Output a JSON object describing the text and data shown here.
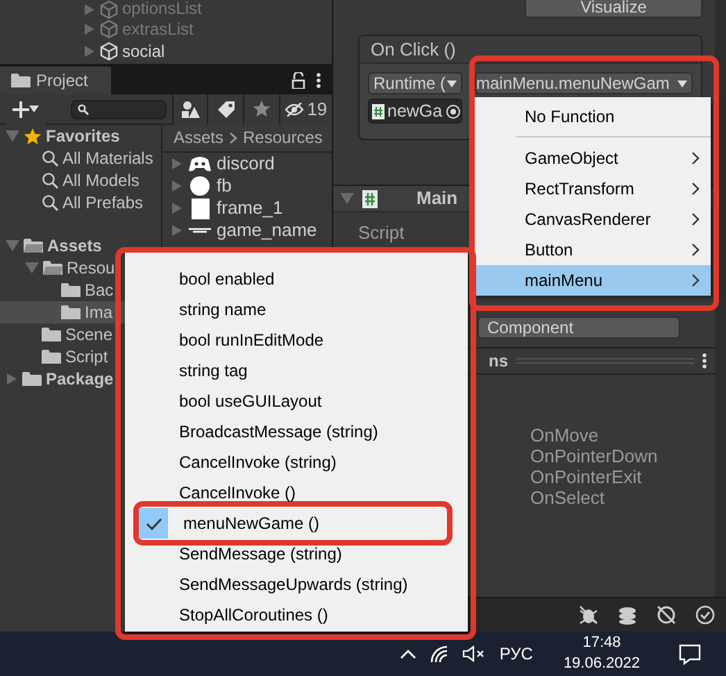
{
  "hierarchy": [
    {
      "label": "optionsList",
      "active": false
    },
    {
      "label": "extrasList",
      "active": false
    },
    {
      "label": "social",
      "active": true
    }
  ],
  "project": {
    "tab": "Project",
    "hidden_count": "19",
    "tree": [
      {
        "label": "Favorites",
        "kind": "favorites",
        "expanded": true,
        "selected": false,
        "children": [
          {
            "label": "All Materials",
            "kind": "search",
            "selected": false
          },
          {
            "label": "All Models",
            "kind": "search",
            "selected": false
          },
          {
            "label": "All Prefabs",
            "kind": "search",
            "selected": false
          }
        ]
      },
      {
        "label": "Assets",
        "kind": "folder",
        "expanded": true,
        "selected": false,
        "children": [
          {
            "label": "Resou",
            "kind": "folder",
            "expanded": true,
            "selected": false,
            "children": [
              {
                "label": "Bac",
                "kind": "folder",
                "selected": false
              },
              {
                "label": "Ima",
                "kind": "folder",
                "selected": true
              }
            ]
          },
          {
            "label": "Scene",
            "kind": "folder",
            "selected": false
          },
          {
            "label": "Script",
            "kind": "folder",
            "selected": false
          }
        ]
      },
      {
        "label": "Package",
        "kind": "folder",
        "expanded": false,
        "selected": false
      }
    ],
    "breadcrumb": [
      "Assets",
      "Resources"
    ],
    "assets": [
      {
        "label": "discord",
        "kind": "gamepad"
      },
      {
        "label": "fb",
        "kind": "round"
      },
      {
        "label": "frame_1",
        "kind": "sprite"
      },
      {
        "label": "game_name",
        "kind": "banner"
      }
    ]
  },
  "inspector": {
    "visualize": "Visualize",
    "on_click": {
      "title": "On Click ()",
      "runtime": "Runtime (",
      "function": "mainMenu.menuNewGam",
      "object": "newGa"
    },
    "component": {
      "title": "Main",
      "fields": [
        "Script"
      ],
      "add_button": "Component"
    },
    "events": {
      "title": "ns",
      "rows": [
        {
          "name": "OnMove"
        },
        {
          "name": "OnPointerDown"
        },
        {
          "name": "OnPointerExit"
        },
        {
          "name": "OnSelect"
        }
      ]
    }
  },
  "function_menu": [
    {
      "kind": "plain",
      "label": "No Function",
      "selected": false
    },
    {
      "kind": "separator"
    },
    {
      "kind": "submenu",
      "label": "GameObject",
      "selected": false
    },
    {
      "kind": "submenu",
      "label": "RectTransform",
      "selected": false
    },
    {
      "kind": "submenu",
      "label": "CanvasRenderer",
      "selected": false
    },
    {
      "kind": "submenu",
      "label": "Button",
      "selected": false
    },
    {
      "kind": "submenu",
      "label": "mainMenu",
      "selected": true
    }
  ],
  "method_menu": [
    {
      "label": "bool enabled",
      "checked": false
    },
    {
      "label": "string name",
      "checked": false
    },
    {
      "label": "bool runInEditMode",
      "checked": false
    },
    {
      "label": "string tag",
      "checked": false
    },
    {
      "label": "bool useGUILayout",
      "checked": false
    },
    {
      "label": "BroadcastMessage (string)",
      "checked": false
    },
    {
      "label": "CancelInvoke (string)",
      "checked": false
    },
    {
      "label": "CancelInvoke ()",
      "checked": false
    },
    {
      "label": "menuNewGame ()",
      "checked": true
    },
    {
      "label": "SendMessage (string)",
      "checked": false
    },
    {
      "label": "SendMessageUpwards (string)",
      "checked": false
    },
    {
      "label": "StopAllCoroutines ()",
      "checked": false
    }
  ],
  "taskbar": {
    "language": "РУС",
    "time": "17:48",
    "date": "19.06.2022"
  }
}
